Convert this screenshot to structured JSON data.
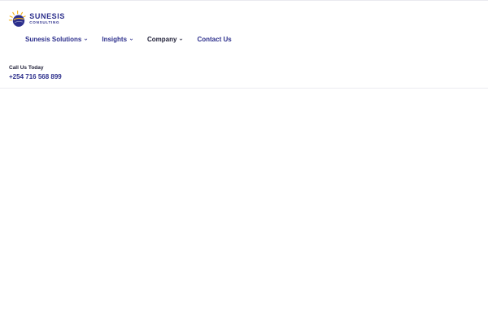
{
  "brand": {
    "name": "SUNESIS",
    "tagline": "CONSULTING",
    "colors": {
      "navy": "#2c2f8c",
      "sun": "#f2b41f",
      "dark": "#22223a"
    }
  },
  "nav": {
    "items": [
      {
        "label": "Sunesis Solutions",
        "has_dropdown": true,
        "icon": "chevron-down-icon"
      },
      {
        "label": "Insights",
        "has_dropdown": true,
        "icon": "chevron-down-icon"
      },
      {
        "label": "Company",
        "has_dropdown": true,
        "icon": "chevron-down-icon"
      },
      {
        "label": "Contact Us",
        "has_dropdown": false
      }
    ]
  },
  "contact": {
    "label": "Call Us Today",
    "phone": "+254 716 568 899"
  }
}
